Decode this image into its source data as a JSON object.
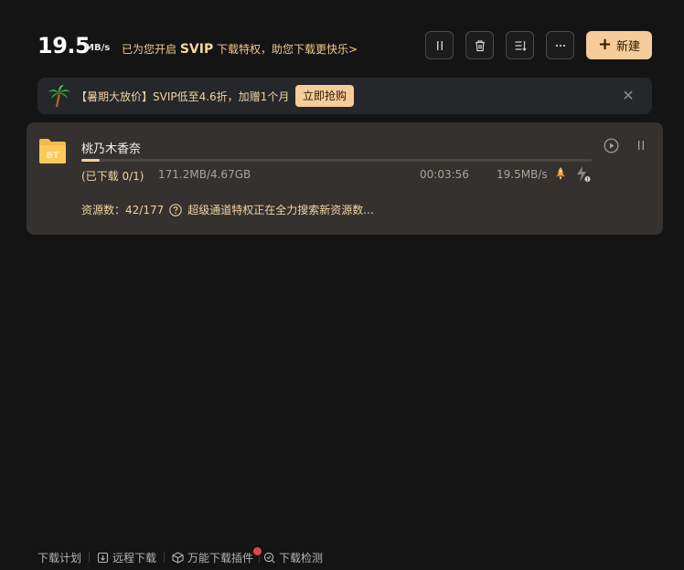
{
  "header": {
    "speed_value": "19.5",
    "speed_unit": "MB/s",
    "svip_prefix": "已为您开启 ",
    "svip_word": "SVIP",
    "svip_suffix": " 下载特权，助您下载更快乐>",
    "new_button_label": "新建"
  },
  "banner": {
    "promo_text": "【暑期大放价】SVIP低至4.6折，加赠1个月",
    "button_label": "立即抢购",
    "close_symbol": "✕"
  },
  "task": {
    "name": "桃乃木香奈",
    "progress_fraction": 0.036,
    "status": "(已下载 0/1)",
    "size": "171.2MB/4.67GB",
    "time_left": "00:03:56",
    "speed": "19.5MB/s",
    "source_label": "资源数：42/177",
    "source_message": "超级通道特权正在全力搜索新资源数...",
    "icon_text": "BT"
  },
  "bottom_bar": {
    "items": [
      "下载计划",
      "远程下载",
      "万能下载插件",
      "下载检测"
    ]
  },
  "colors": {
    "accent": "#f6cc9a",
    "accent_text": "#f1d3a3",
    "background": "#141414",
    "card": "#34312e",
    "banner": "#25272b",
    "badge_red": "#e0484a"
  }
}
